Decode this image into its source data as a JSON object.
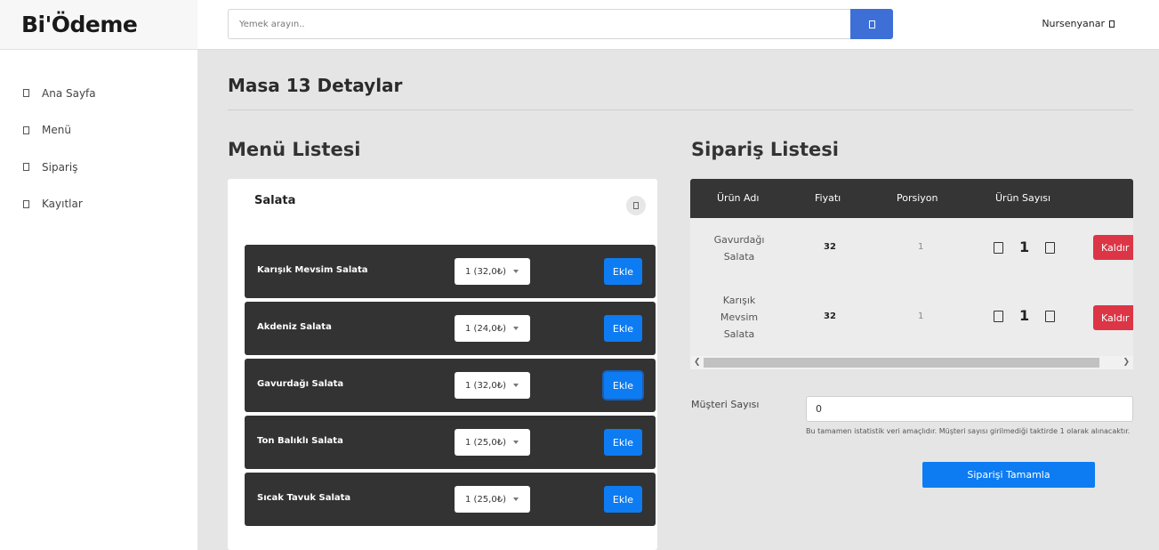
{
  "brand": "Bi'Ödeme",
  "search": {
    "placeholder": "Yemek arayın..",
    "button_icon": "search-icon"
  },
  "user": {
    "name": "Nursenyanar",
    "icon": "chevron-down-icon"
  },
  "sidebar": {
    "items": [
      {
        "label": "Ana Sayfa",
        "icon": "home-icon"
      },
      {
        "label": "Menü",
        "icon": "menu-icon"
      },
      {
        "label": "Sipariş",
        "icon": "order-icon"
      },
      {
        "label": "Kayıtlar",
        "icon": "records-icon"
      }
    ]
  },
  "page": {
    "title": "Masa 13 Detaylar"
  },
  "menu": {
    "title": "Menü Listesi",
    "category": "Salata",
    "items": [
      {
        "name": "Karışık Mevsim Salata",
        "portion": "1 (32,0₺)",
        "button": "Ekle"
      },
      {
        "name": "Akdeniz Salata",
        "portion": "1 (24,0₺)",
        "button": "Ekle"
      },
      {
        "name": "Gavurdağı Salata",
        "portion": "1 (32,0₺)",
        "button": "Ekle"
      },
      {
        "name": "Ton Balıklı Salata",
        "portion": "1 (25,0₺)",
        "button": "Ekle"
      },
      {
        "name": "Sıcak Tavuk Salata",
        "portion": "1 (25,0₺)",
        "button": "Ekle"
      }
    ]
  },
  "order": {
    "title": "Sipariş Listesi",
    "headers": [
      "Ürün Adı",
      "Fiyatı",
      "Porsiyon",
      "Ürün Sayısı"
    ],
    "rows": [
      {
        "name_lines": [
          "Gavurdağı",
          "Salata"
        ],
        "price": "32",
        "portion": "1",
        "count": "1",
        "remove": "Kaldır"
      },
      {
        "name_lines": [
          "Karışık",
          "Mevsim",
          "Salata"
        ],
        "price": "32",
        "portion": "1",
        "count": "1",
        "remove": "Kaldır"
      }
    ]
  },
  "customers": {
    "label": "Müşteri Sayısı",
    "value": "0",
    "hint": "Bu tamamen istatistik veri amaçlıdır. Müşteri sayısı girilmediği taktirde 1 olarak alınacaktır."
  },
  "complete_button": "Siparişi Tamamla",
  "colors": {
    "primary": "#0d7cf2",
    "danger": "#dc3545",
    "dark": "#333333"
  }
}
